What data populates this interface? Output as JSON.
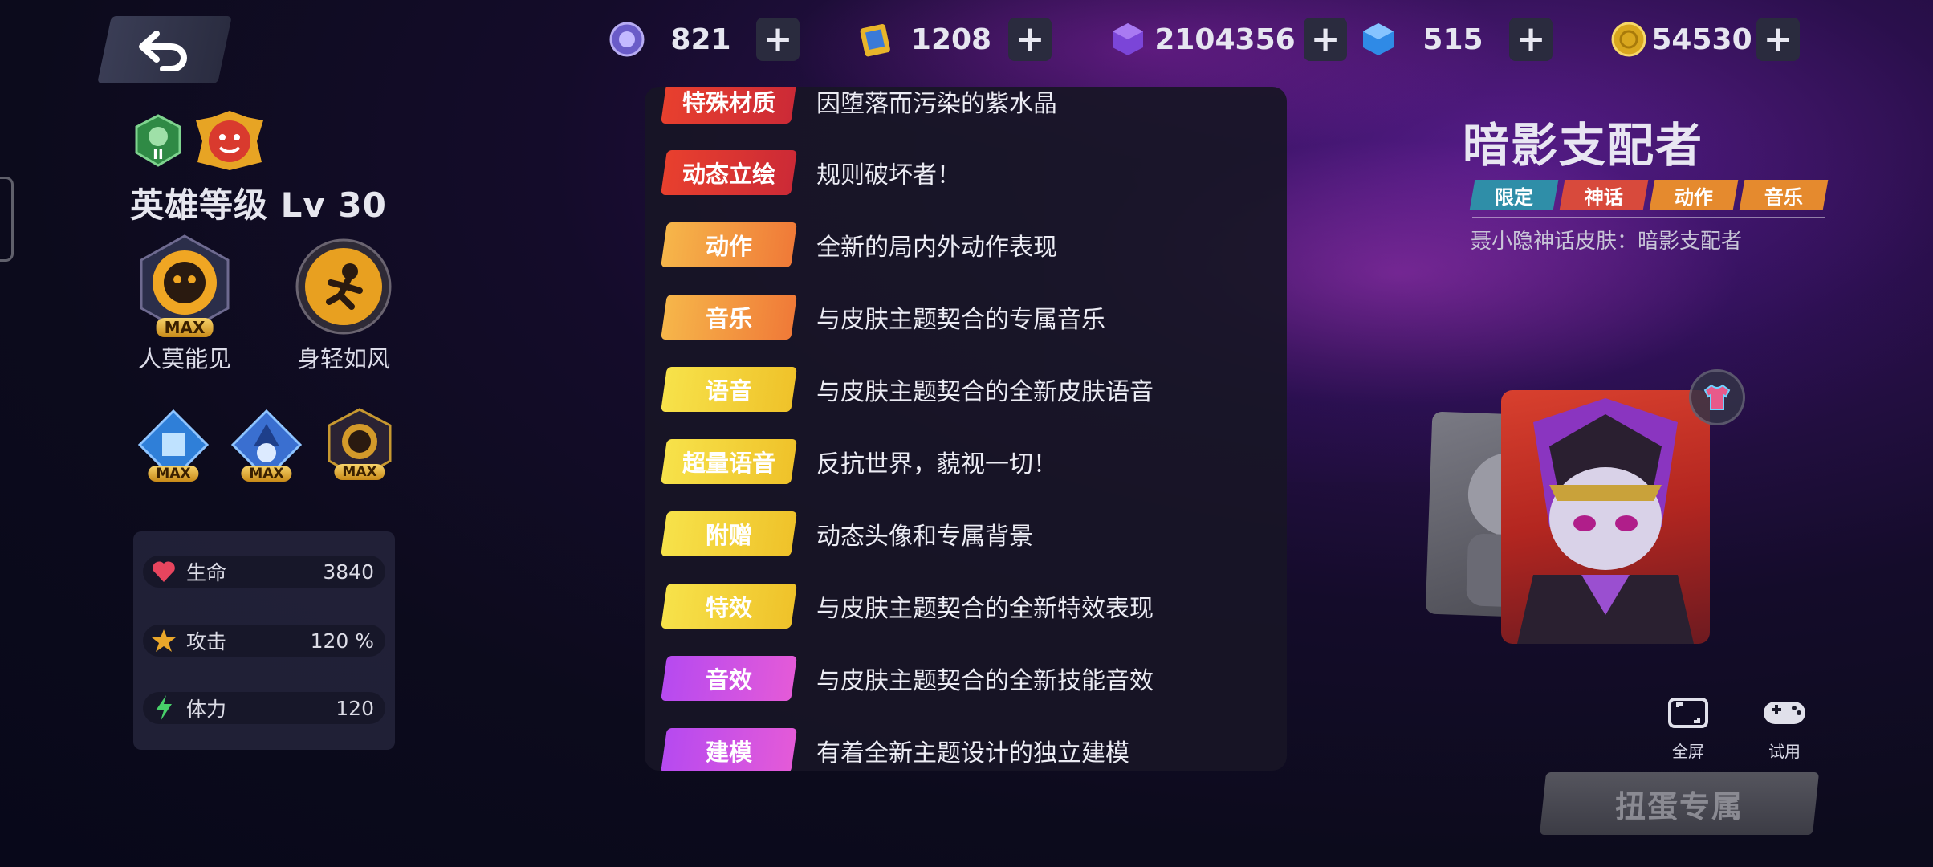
{
  "colors": {
    "red_tag": "#e23a36",
    "orange_tag": "#f59a3a",
    "yellow_tag": "#f3d530",
    "purple_tag": "#c448e6",
    "limited_tag": "#2f8ea8",
    "myth_tag": "#d84a3c",
    "action_tag": "#e58a2e",
    "music_tag": "#e58a2e"
  },
  "currencies": [
    {
      "icon": "purple-orb-icon",
      "value": "821"
    },
    {
      "icon": "ticket-icon",
      "value": "1208"
    },
    {
      "icon": "purple-gem-icon",
      "value": "2104356"
    },
    {
      "icon": "blue-gem-icon",
      "value": "515"
    },
    {
      "icon": "gold-coin-icon",
      "value": "54530"
    }
  ],
  "left": {
    "rank_numeral": "II",
    "hero_level": "英雄等级 Lv 30",
    "skills": [
      {
        "label": "人莫能见",
        "badge": "MAX"
      },
      {
        "label": "身轻如风"
      }
    ],
    "runes": [
      {
        "badge": "MAX"
      },
      {
        "badge": "MAX"
      },
      {
        "badge": "MAX"
      }
    ],
    "stats": [
      {
        "icon": "heart-icon",
        "label": "生命",
        "value": "3840"
      },
      {
        "icon": "attack-icon",
        "label": "攻击",
        "value": "120 %"
      },
      {
        "icon": "lightning-icon",
        "label": "体力",
        "value": "120"
      }
    ]
  },
  "features": [
    {
      "tag": "特殊材质",
      "desc": "因堕落而污染的紫水晶",
      "color": "red"
    },
    {
      "tag": "动态立绘",
      "desc": "规则破坏者！",
      "color": "red"
    },
    {
      "tag": "动作",
      "desc": "全新的局内外动作表现",
      "color": "orange"
    },
    {
      "tag": "音乐",
      "desc": "与皮肤主题契合的专属音乐",
      "color": "orange"
    },
    {
      "tag": "语音",
      "desc": "与皮肤主题契合的全新皮肤语音",
      "color": "yellow"
    },
    {
      "tag": "超量语音",
      "desc": "反抗世界，藐视一切！",
      "color": "yellow"
    },
    {
      "tag": "附赠",
      "desc": "动态头像和专属背景",
      "color": "yellow"
    },
    {
      "tag": "特效",
      "desc": "与皮肤主题契合的全新特效表现",
      "color": "yellow"
    },
    {
      "tag": "音效",
      "desc": "与皮肤主题契合的全新技能音效",
      "color": "purple"
    },
    {
      "tag": "建模",
      "desc": "有着全新主题设计的独立建模",
      "color": "purple"
    }
  ],
  "skin": {
    "title": "暗影支配者",
    "tags": [
      "限定",
      "神话",
      "动作",
      "音乐"
    ],
    "subtitle": "聂小隐神话皮肤：暗影支配者"
  },
  "buttons": {
    "fullscreen": "全屏",
    "trial": "试用",
    "gacha": "扭蛋专属"
  }
}
